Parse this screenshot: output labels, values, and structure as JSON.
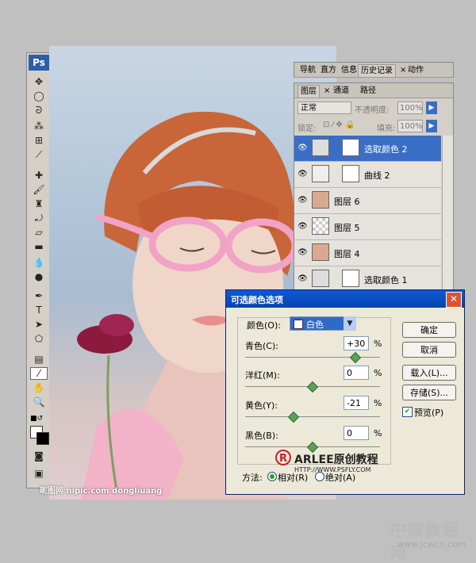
{
  "app": {
    "logo": "Ps"
  },
  "panel_tabs_top": [
    {
      "label": "导航",
      "active": false
    },
    {
      "label": "直方",
      "active": false
    },
    {
      "label": "信息",
      "active": false
    },
    {
      "label": "历史记录",
      "active": true
    },
    {
      "label": "×",
      "active": false
    },
    {
      "label": "动作",
      "active": false
    }
  ],
  "panel_tabs": [
    {
      "label": "图层",
      "active": true
    },
    {
      "label": "×",
      "active": false
    },
    {
      "label": "通道",
      "active": false
    },
    {
      "label": "路径",
      "active": false
    }
  ],
  "layers_controls": {
    "blend_mode": "正常",
    "opacity_label": "不透明度:",
    "opacity_value": "100%",
    "lock_label": "锁定:",
    "fill_label": "填充:",
    "fill_value": "100%"
  },
  "layers": [
    {
      "name": "选取颜色 2",
      "selected": true
    },
    {
      "name": "曲线 2",
      "selected": false
    },
    {
      "name": "图层 6",
      "selected": false
    },
    {
      "name": "图层 5",
      "selected": false
    },
    {
      "name": "图层 4",
      "selected": false
    },
    {
      "name": "选取颜色 1",
      "selected": false
    }
  ],
  "dialog": {
    "title": "可选颜色选项",
    "color_label": "颜色(O):",
    "color_value": "白色",
    "sliders": [
      {
        "label": "青色(C):",
        "value": "+30",
        "fraction": 0.82
      },
      {
        "label": "洋红(M):",
        "value": "0",
        "fraction": 0.5
      },
      {
        "label": "黄色(Y):",
        "value": "-21",
        "fraction": 0.36
      },
      {
        "label": "黑色(B):",
        "value": "0",
        "fraction": 0.5
      }
    ],
    "percent": "%",
    "buttons": {
      "ok": "确定",
      "cancel": "取消",
      "load": "载入(L)...",
      "save": "存储(S)..."
    },
    "preview_label": "预览(P)",
    "preview_checked": true,
    "method_label": "方法:",
    "method_relative": "相对(R)",
    "method_absolute": "绝对(A)",
    "method_selected": "relative"
  },
  "watermarks": {
    "arlee_brand": "ARLEE原创教程",
    "arlee_url": "HTTP://WWW.PSFLY.COM",
    "bottom_left": "昵图网 nipic.com dongliuang",
    "cn_brand": "中国教程网",
    "cn_url": "www.jcwcn.com"
  },
  "colors": {
    "selection_blue": "#3a6ec6",
    "title_blue": "#0a5bd6",
    "close_red": "#d8552f"
  }
}
